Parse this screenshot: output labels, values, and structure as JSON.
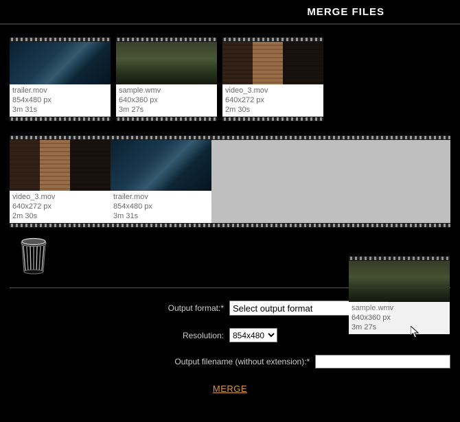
{
  "header": {
    "title": "MERGE FILES"
  },
  "source_clips": [
    {
      "name": "trailer.mov",
      "dims": "854x480 px",
      "dur": "3m 31s",
      "thumb": "avatar"
    },
    {
      "name": "sample.wmv",
      "dims": "640x360 px",
      "dur": "3m 27s",
      "thumb": "jungle"
    },
    {
      "name": "video_3.mov",
      "dims": "640x272 px",
      "dur": "2m 30s",
      "thumb": "blinds"
    }
  ],
  "target_clips": [
    {
      "name": "video_3.mov",
      "dims": "640x272 px",
      "dur": "2m 30s",
      "thumb": "blinds"
    },
    {
      "name": "trailer.mov",
      "dims": "854x480 px",
      "dur": "3m 31s",
      "thumb": "avatar"
    }
  ],
  "drag_ghost": {
    "name": "sample.wmv",
    "dims": "640x360 px",
    "dur": "3m 27s",
    "thumb": "jungle"
  },
  "form": {
    "output_format_label": "Output format:",
    "output_format_placeholder": "Select output format",
    "resolution_label": "Resolution:",
    "resolution_value": "854x480",
    "filename_label": "Output filename (without extension):",
    "filename_value": "",
    "required_mark": "*",
    "merge_label": "MERGE"
  }
}
